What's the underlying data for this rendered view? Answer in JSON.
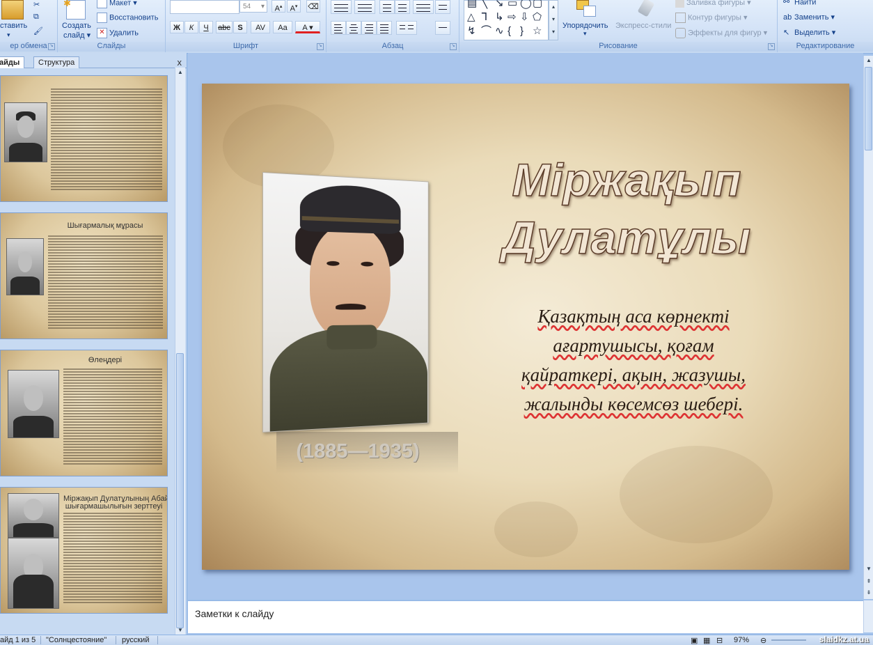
{
  "ribbon": {
    "clipboard": {
      "paste_label": "ставить",
      "group_label": "ер обмена"
    },
    "slides": {
      "create_label_1": "Создать",
      "create_label_2": "слайд",
      "layout_label": "Макет",
      "reset_label": "Восстановить",
      "delete_label": "Удалить",
      "group_label": "Слайды"
    },
    "font": {
      "font_name": "",
      "font_size": "54",
      "bold": "Ж",
      "italic": "К",
      "underline": "Ч",
      "strike": "abc",
      "shadow": "S",
      "spacing": "AV",
      "case": "Aa",
      "color": "A",
      "group_label": "Шрифт"
    },
    "paragraph": {
      "group_label": "Абзац"
    },
    "drawing": {
      "arrange_label": "Упорядочить",
      "quick_styles_label": "Экспресс-стили",
      "fill_label": "Заливка фигуры",
      "outline_label": "Контур фигуры",
      "effects_label": "Эффекты для фигур",
      "group_label": "Рисование"
    },
    "editing": {
      "find_label": "Найти",
      "replace_label": "Заменить",
      "select_label": "Выделить",
      "group_label": "Редактирование"
    }
  },
  "panel": {
    "tab_slides": "айды",
    "tab_outline": "Структура",
    "close": "x",
    "thumbnails": [
      {
        "title": ""
      },
      {
        "title": "Шығармалық мұрасы"
      },
      {
        "title": "Өлеңдері"
      },
      {
        "title": "Міржақып Дулатұлының Абай",
        "title2": "шығармашылығын зерттеуі"
      }
    ]
  },
  "slide": {
    "title_line1": "Міржақып",
    "title_line2": "Дулатұлы",
    "subtitle_line1": "Қазақтың аса көрнекті",
    "subtitle_line2": "ағартушысы, қоғам",
    "subtitle_line3": "қайраткері, ақын, жазушы,",
    "subtitle_line4": "жалынды көсемсөз шебері.",
    "years": "(1885—1935)"
  },
  "notes": {
    "placeholder": "Заметки к слайду"
  },
  "status": {
    "slide_counter": "айд 1 из 5",
    "theme": "\"Солнцестояние\"",
    "language": "русский",
    "zoom": "97%",
    "watermark": "slaidkz.at.ua"
  },
  "colors": {
    "ribbon_bg": "#d4e3f7",
    "panel_bg": "#c7daf2",
    "canvas_bg": "#a9c5ec",
    "selection": "#e1a93b",
    "title_fill": "#f2e6d4",
    "title_outline": "#5a3b28"
  }
}
